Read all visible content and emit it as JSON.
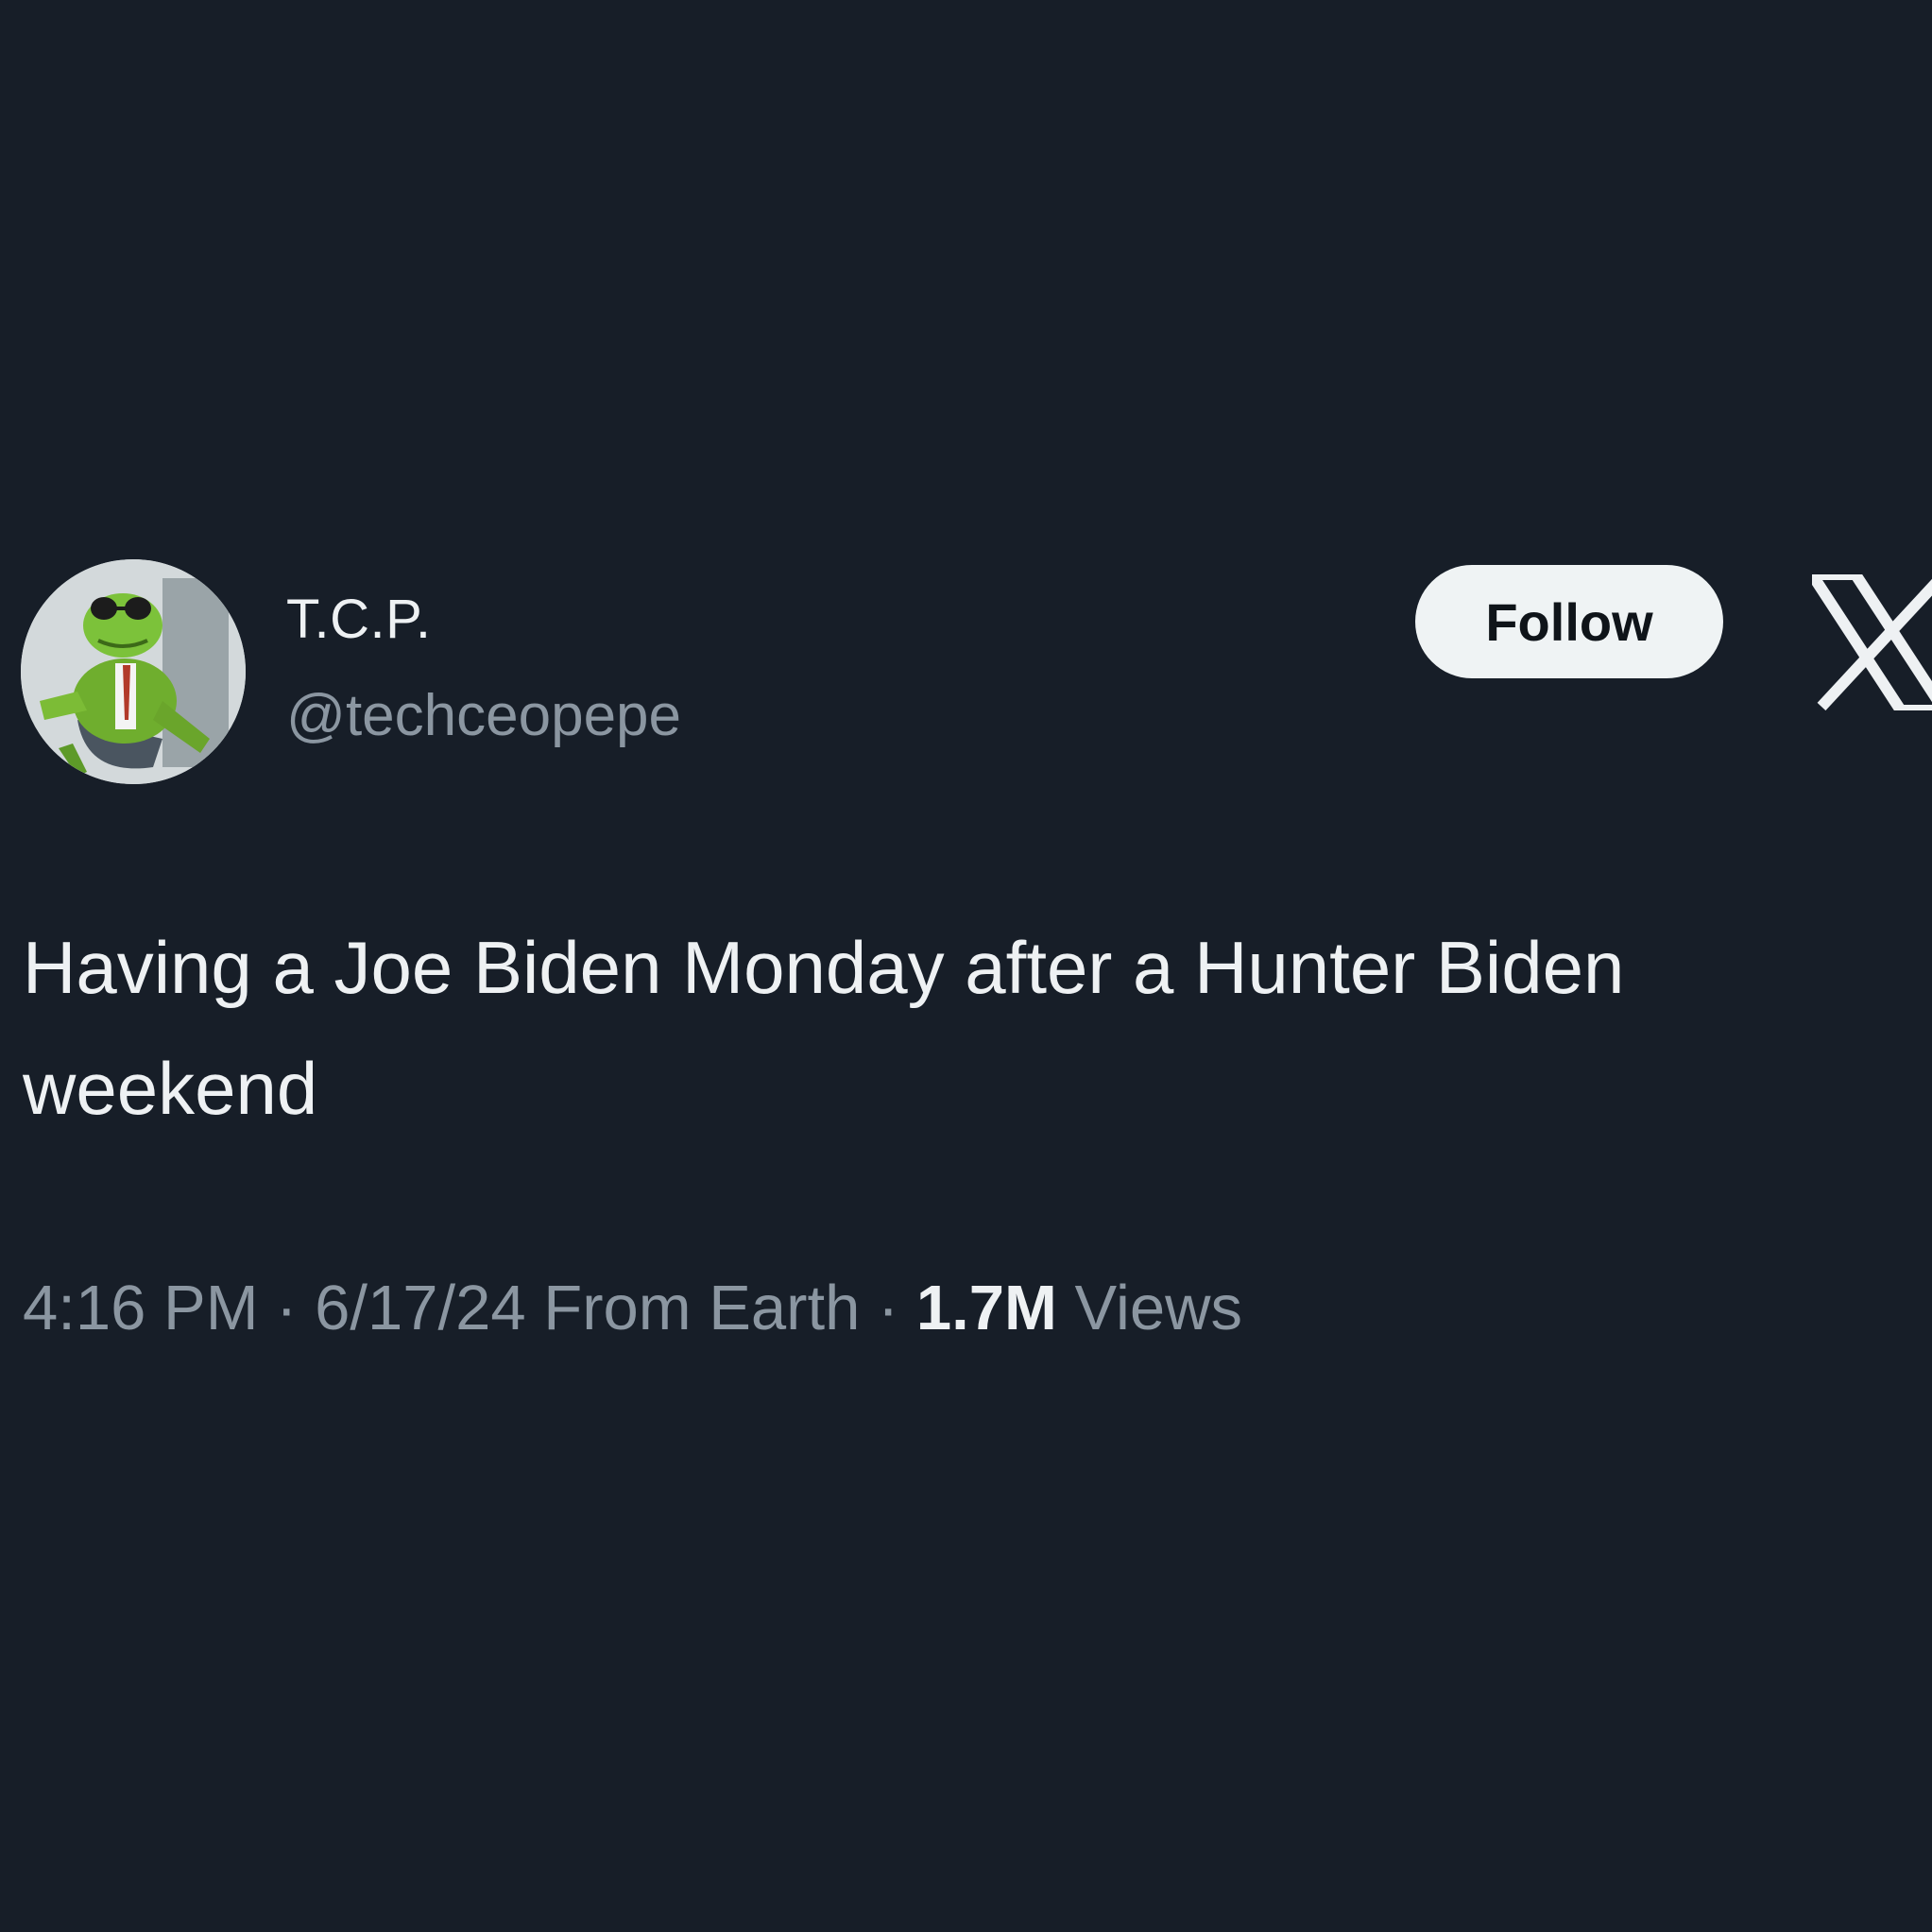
{
  "author": {
    "display_name": "T.C.P.",
    "handle": "@techceopepe",
    "avatar_icon": "frog-in-suit-avatar"
  },
  "follow_button": {
    "label": "Follow"
  },
  "platform_icon": "x-logo-icon",
  "tweet": {
    "text": "Having a Joe Biden Monday after a Hunter Biden weekend"
  },
  "meta": {
    "time": "4:16 PM",
    "separator": "·",
    "date": "6/17/24",
    "source": "From Earth",
    "views_count": "1.7M",
    "views_label": "Views"
  },
  "colors": {
    "background": "#171e28",
    "primary_text": "#eef1f3",
    "secondary_text": "#8b96a1",
    "button_bg": "#eff3f4"
  }
}
